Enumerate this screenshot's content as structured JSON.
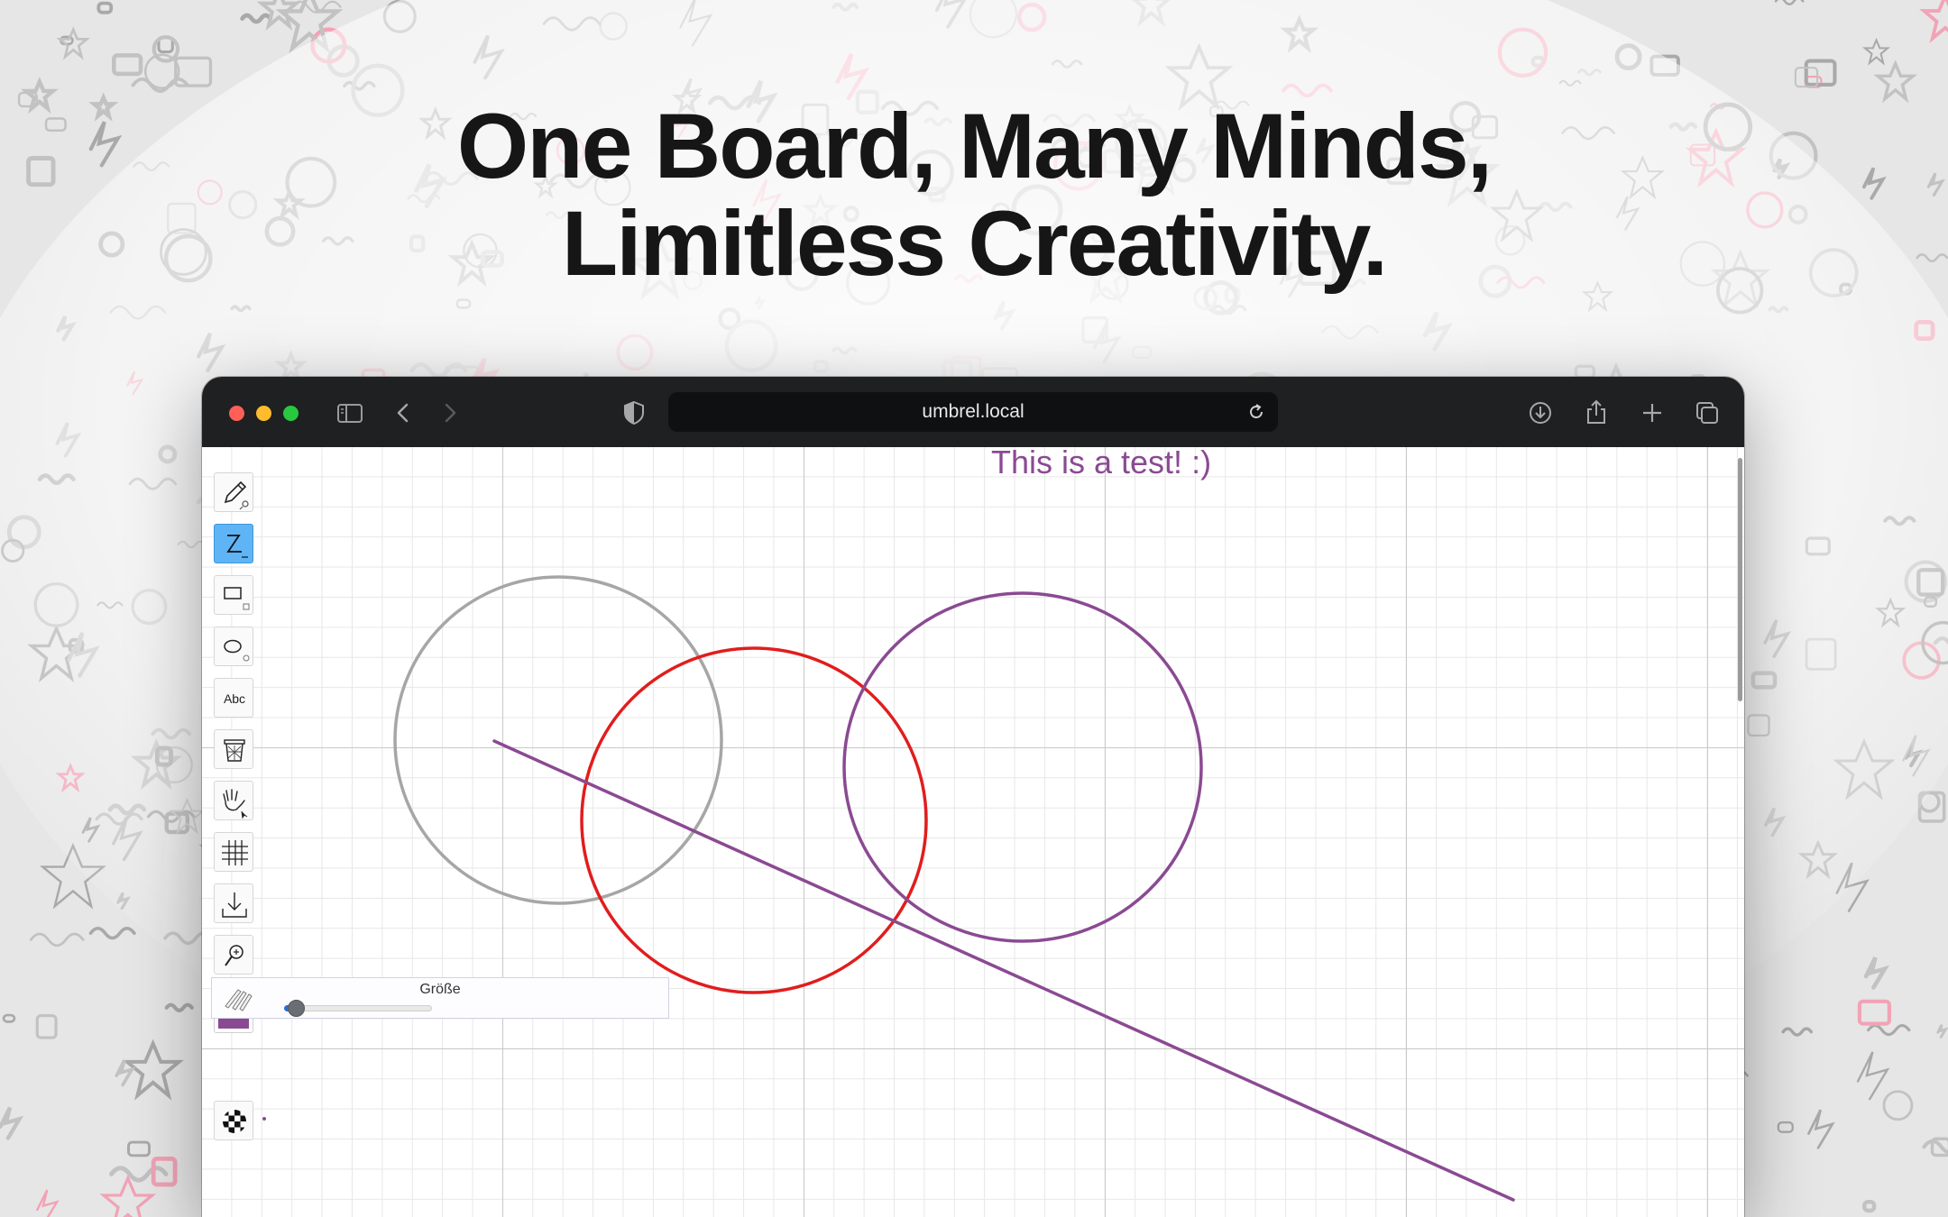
{
  "headline": {
    "line1": "One Board, Many Minds,",
    "line2": "Limitless Creativity."
  },
  "browser": {
    "url": "umbrel.local",
    "traffic_colors": [
      "#ff5f57",
      "#febc2e",
      "#28c840"
    ],
    "toolbar_icons": [
      "sidebar-icon",
      "back-icon",
      "forward-icon",
      "shield-icon",
      "reload-icon",
      "download-icon",
      "share-icon",
      "new-tab-icon",
      "tab-overview-icon"
    ]
  },
  "whiteboard": {
    "text_note": "This is a test! :)",
    "text_color": "#8a4a92",
    "tools": [
      {
        "name": "pencil",
        "icon": "pencil-icon",
        "active": false
      },
      {
        "name": "line",
        "icon": "line-icon",
        "active": true
      },
      {
        "name": "rectangle",
        "icon": "rectangle-icon",
        "active": false
      },
      {
        "name": "ellipse",
        "icon": "ellipse-icon",
        "active": false
      },
      {
        "name": "text",
        "icon": "text-icon",
        "label": "Abc",
        "active": false
      },
      {
        "name": "clear",
        "icon": "trash-icon",
        "active": false
      },
      {
        "name": "pan",
        "icon": "hand-icon",
        "active": false
      },
      {
        "name": "grid",
        "icon": "grid-icon",
        "active": false
      },
      {
        "name": "download",
        "icon": "download-icon",
        "active": false
      },
      {
        "name": "zoom",
        "icon": "zoom-icon",
        "active": false
      }
    ],
    "current_color": "#8a4a92",
    "size_panel": {
      "label": "Größe",
      "value_fraction": 0.08
    },
    "shapes_colors": {
      "gray": "#a6a6a6",
      "red": "#e11d1d",
      "purple": "#8a4a92"
    }
  }
}
